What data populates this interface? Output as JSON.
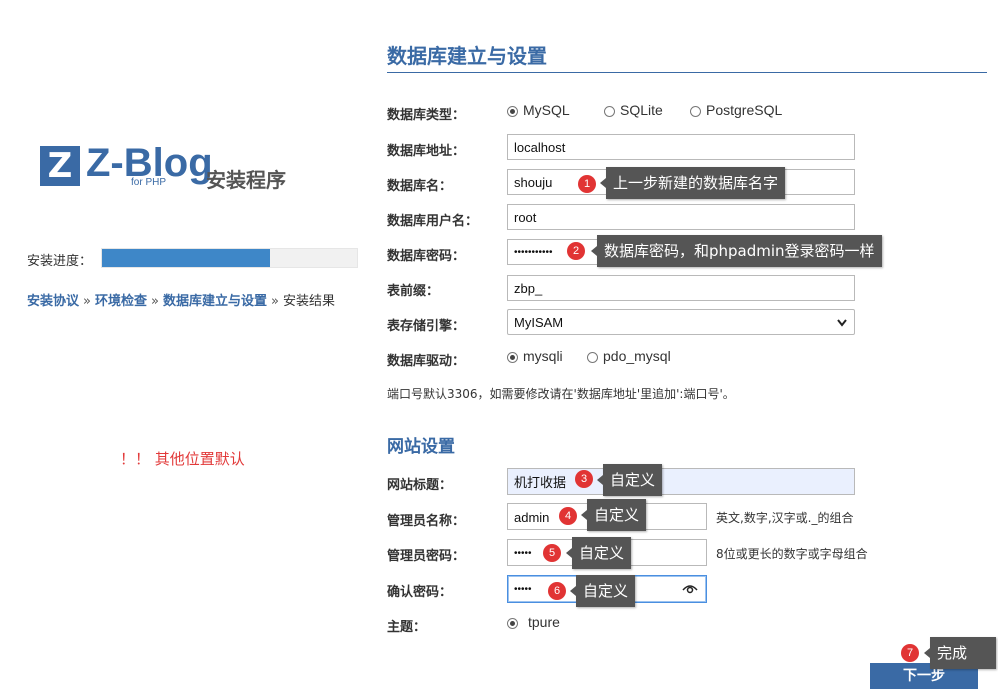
{
  "left": {
    "logo_mark": "Z",
    "logo_text": "Z-Blog",
    "logo_sub": "for PHP",
    "install_title": "安装程序",
    "progress_label": "安装进度：",
    "progress_value": 0.66,
    "steps": [
      "安装协议",
      "环境检查",
      "数据库建立与设置",
      "安装结果"
    ],
    "step_sep": "»",
    "note": "！！ 其他位置默认"
  },
  "db": {
    "title": "数据库建立与设置",
    "type_label": "数据库类型：",
    "type_options": [
      "MySQL",
      "SQLite",
      "PostgreSQL"
    ],
    "host_label": "数据库地址：",
    "host_value": "localhost",
    "name_label": "数据库名：",
    "name_value": "shouju",
    "user_label": "数据库用户名：",
    "user_value": "root",
    "pass_label": "数据库密码：",
    "pass_value": "•••••••••••",
    "prefix_label": "表前缀：",
    "prefix_value": "zbp_",
    "engine_label": "表存储引擎：",
    "engine_value": "MyISAM",
    "driver_label": "数据库驱动：",
    "driver_options": [
      "mysqli",
      "pdo_mysql"
    ],
    "port_hint": "端口号默认3306，如需要修改请在'数据库地址'里追加':端口号'。"
  },
  "site": {
    "title": "网站设置",
    "site_title_label": "网站标题：",
    "site_title_value": "机打收据",
    "admin_label": "管理员名称：",
    "admin_value": "admin",
    "admin_hint": "英文,数字,汉字或._的组合",
    "admin_pass_label": "管理员密码：",
    "admin_pass_value": "•••••",
    "admin_pass_hint": "8位或更长的数字或字母组合",
    "confirm_label": "确认密码：",
    "confirm_value": "•••••",
    "theme_label": "主题：",
    "theme_value": "tpure",
    "next_label": "下一步"
  },
  "tips": [
    {
      "num": "1",
      "text": "上一步新建的数据库名字"
    },
    {
      "num": "2",
      "text": "数据库密码，和phpadmin登录密码一样"
    },
    {
      "num": "3",
      "text": "自定义"
    },
    {
      "num": "4",
      "text": "自定义"
    },
    {
      "num": "5",
      "text": "自定义"
    },
    {
      "num": "6",
      "text": "自定义"
    },
    {
      "num": "7",
      "text": "完成"
    }
  ],
  "colors": {
    "accent": "#3a6aa5",
    "progress": "#3e87c8",
    "badge": "#e13434",
    "tip": "#555555",
    "note": "#e23a3a"
  }
}
